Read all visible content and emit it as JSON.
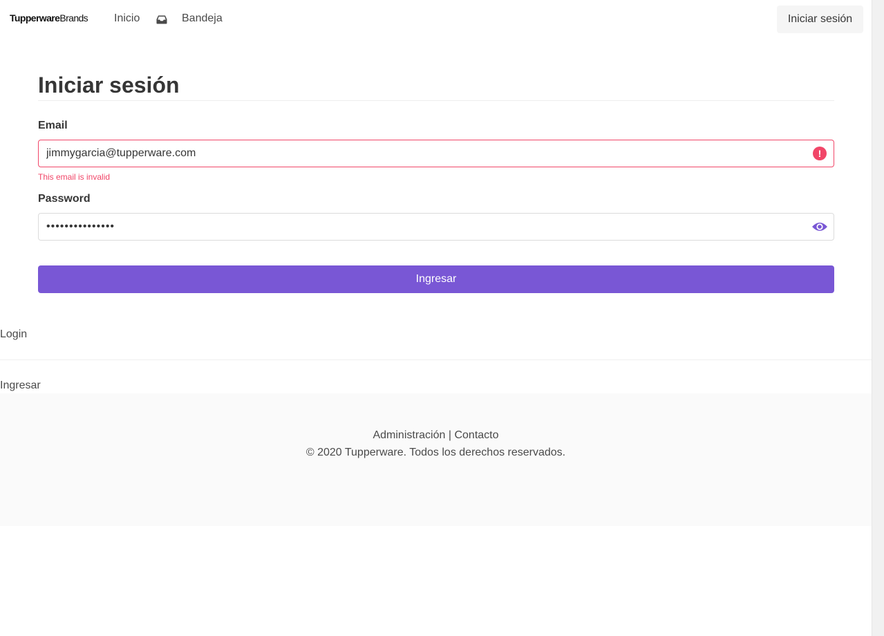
{
  "navbar": {
    "brand_bold": "Tupperware",
    "brand_light": "Brands",
    "links": [
      {
        "label": "Inicio"
      },
      {
        "label": "Bandeja",
        "icon": "inbox-icon"
      }
    ],
    "login_button": "Iniciar sesión"
  },
  "form": {
    "title": "Iniciar sesión",
    "email": {
      "label": "Email",
      "value": "jimmygarcia@tupperware.com",
      "error": "This email is invalid",
      "status_icon": "alert-circle-icon",
      "status_color": "#f14668"
    },
    "password": {
      "label": "Password",
      "value": "•••••••••••••••",
      "toggle_icon": "eye-icon"
    },
    "submit_label": "Ingresar",
    "accent_color": "#7957d5"
  },
  "stray": {
    "login_text": "Login",
    "ingresar_text": "Ingresar"
  },
  "footer": {
    "admin_link": "Administración",
    "separator": "|",
    "contact_link": "Contacto",
    "copyright": "© 2020 Tupperware. Todos los derechos reservados."
  }
}
